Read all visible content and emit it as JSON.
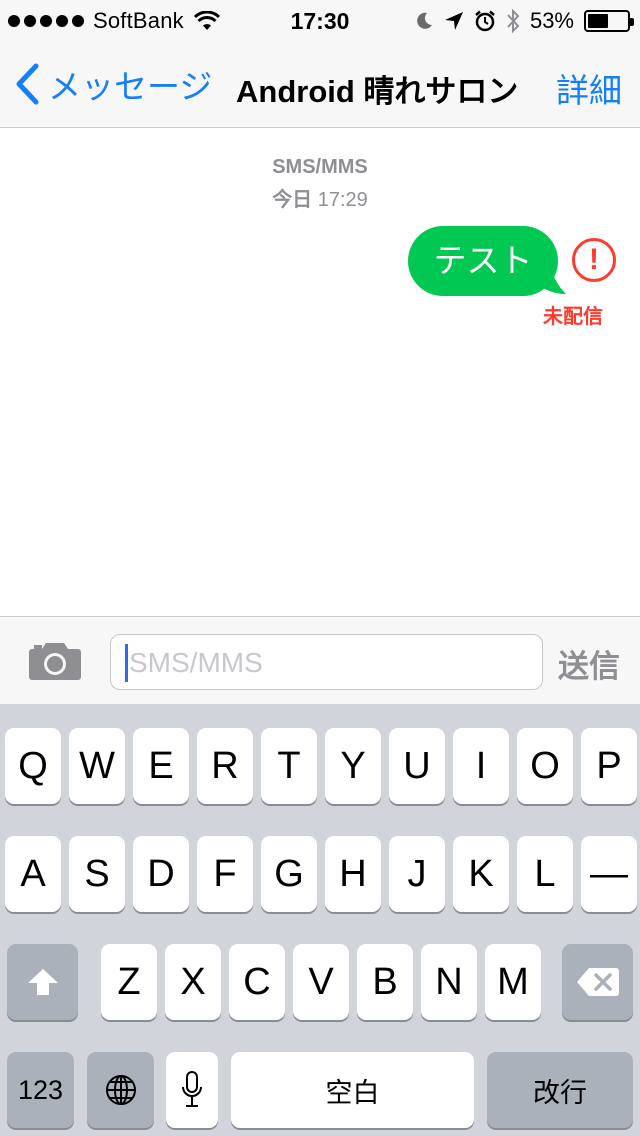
{
  "status_bar": {
    "carrier": "SoftBank",
    "time": "17:30",
    "battery_percent": "53%",
    "battery_level": 0.53,
    "icons": [
      "signal-dots-icon",
      "wifi-icon",
      "moon-icon",
      "location-arrow-icon",
      "alarm-icon",
      "bluetooth-icon",
      "battery-icon"
    ]
  },
  "nav": {
    "back_label": "メッセージ",
    "title": "Android 晴れサロン",
    "details_label": "詳細"
  },
  "conversation": {
    "service": "SMS/MMS",
    "date_day": "今日",
    "date_time": "17:29",
    "messages": [
      {
        "text": "テスト",
        "status": "未配信",
        "bubble_color": "#00c853",
        "error_color": "#ff3b30"
      }
    ]
  },
  "input": {
    "placeholder": "SMS/MMS",
    "value": "",
    "send_label": "送信"
  },
  "keyboard": {
    "row1": [
      "Q",
      "W",
      "E",
      "R",
      "T",
      "Y",
      "U",
      "I",
      "O",
      "P"
    ],
    "row2": [
      "A",
      "S",
      "D",
      "F",
      "G",
      "H",
      "J",
      "K",
      "L",
      "—"
    ],
    "row3": [
      "Z",
      "X",
      "C",
      "V",
      "B",
      "N",
      "M"
    ],
    "numbers_label": "123",
    "space_label": "空白",
    "return_label": "改行"
  },
  "colors": {
    "accent": "#157efb",
    "keyboard_bg": "#d1d5db",
    "dark_key": "#abb1ba"
  }
}
